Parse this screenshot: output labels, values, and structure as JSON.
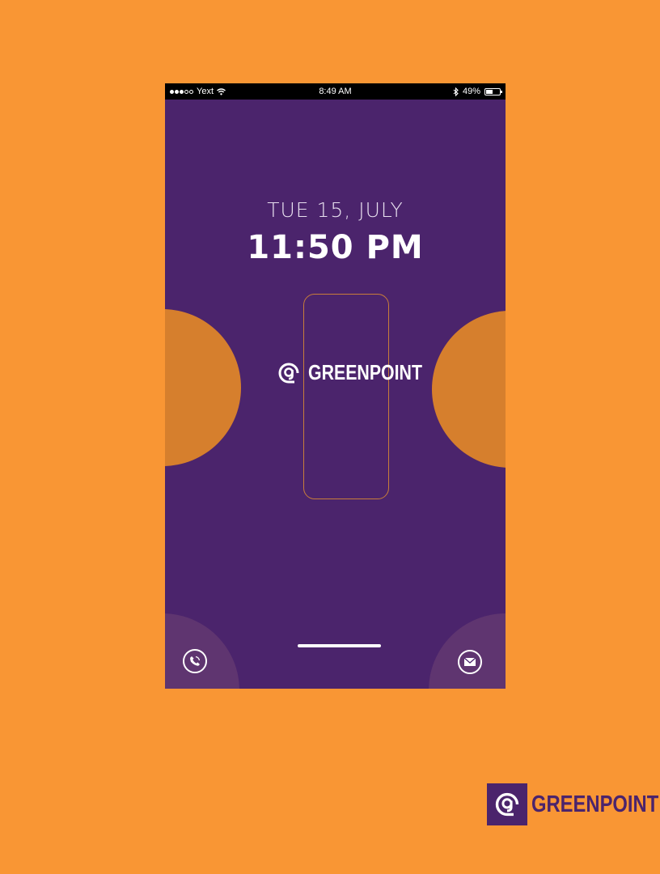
{
  "status_bar": {
    "carrier": "Yext",
    "time": "8:49 AM",
    "battery_percent_label": "49%",
    "battery_level": 0.49
  },
  "lock_screen": {
    "date": "TUE 15, JULY",
    "time": "11:50 PM",
    "logo_text": "GREENPOINT"
  },
  "brand": {
    "name": "GREENPOINT"
  },
  "colors": {
    "background_orange": "#f99634",
    "screen_purple": "#4b246c",
    "circle_orange": "#d67f2d",
    "corner_purple": "#5f3570"
  },
  "icons": {
    "phone": "phone-icon",
    "mail": "mail-icon",
    "bluetooth": "bluetooth-icon",
    "wifi": "wifi-icon",
    "battery": "battery-icon",
    "logo": "greenpoint-logo-icon"
  }
}
